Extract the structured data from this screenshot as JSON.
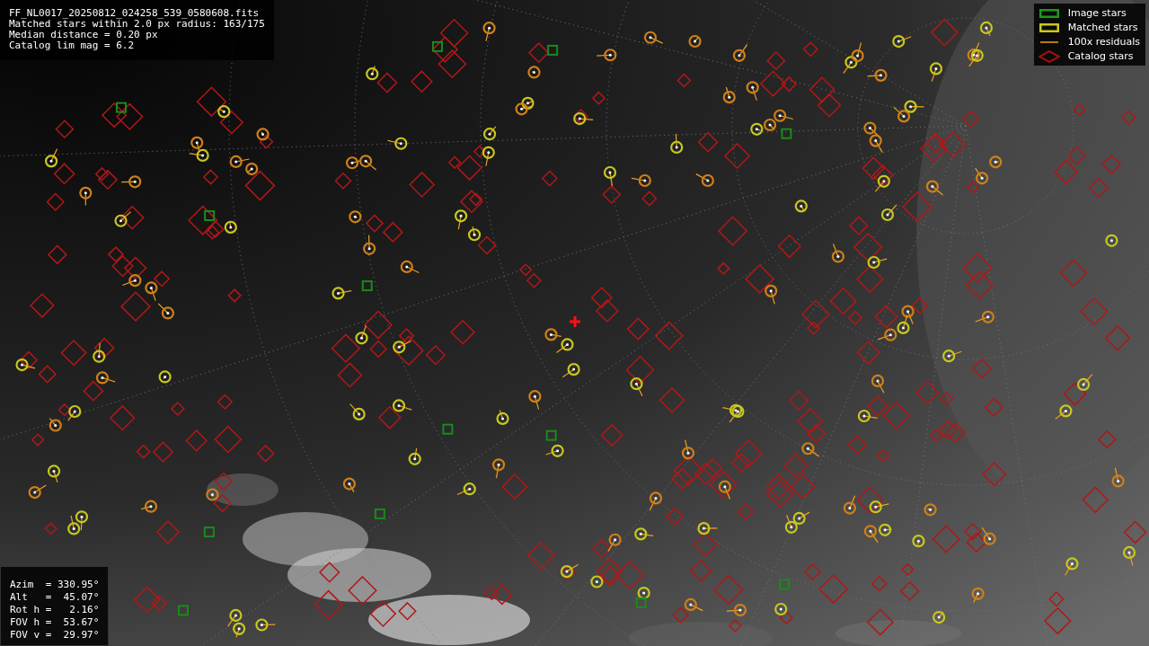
{
  "info": {
    "lines": [
      "FF_NL0017_20250812_024258_539_0580608.fits",
      "Matched stars within 2.0 px radius: 163/175",
      "Median distance = 0.20 px",
      "Catalog lim mag = 6.2"
    ]
  },
  "legend": [
    {
      "label": "Image stars"
    },
    {
      "label": "Matched stars",
      "kind": "matched"
    },
    {
      "label": "100x residuals",
      "kind": "residual"
    },
    {
      "label": "Catalog stars",
      "kind": "catalog"
    }
  ],
  "pointing": [
    "Azim  = 330.95°",
    "Alt   =  45.07°",
    "Rot h =   2.16°",
    "FOV h =  53.67°",
    "FOV v =  29.97°"
  ]
}
